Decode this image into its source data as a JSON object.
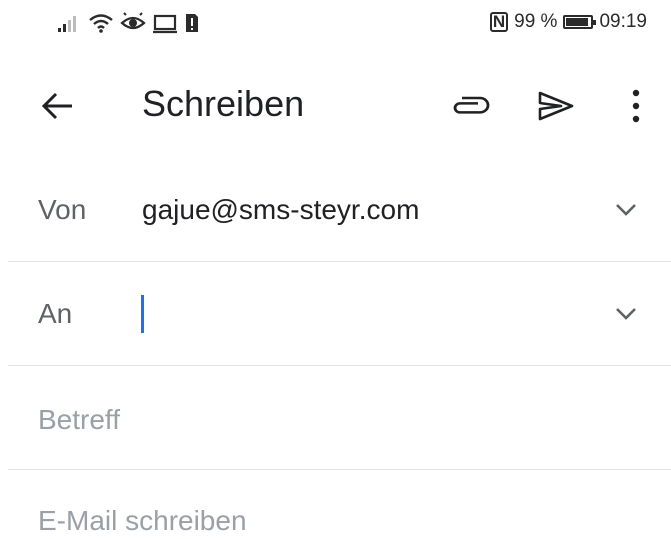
{
  "status_bar": {
    "battery_percent": "99 %",
    "time": "09:19",
    "icons": [
      "signal-icon",
      "wifi-icon",
      "eye-comfort-icon",
      "cast-icon",
      "sim-alert-icon",
      "nfc-icon",
      "battery-icon"
    ]
  },
  "app_bar": {
    "title": "Schreiben",
    "back_icon": "arrow-left-icon",
    "attach_icon": "paperclip-icon",
    "send_icon": "send-icon",
    "more_icon": "more-vert-icon"
  },
  "form": {
    "from_label": "Von",
    "from_value": "gajue@sms-steyr.com",
    "to_label": "An",
    "to_value": "",
    "subject_placeholder": "Betreff",
    "body_placeholder": "E-Mail schreiben"
  },
  "colors": {
    "caret": "#1a73e8",
    "label": "#5f6368",
    "placeholder": "#9aa0a6",
    "text": "#202124"
  }
}
